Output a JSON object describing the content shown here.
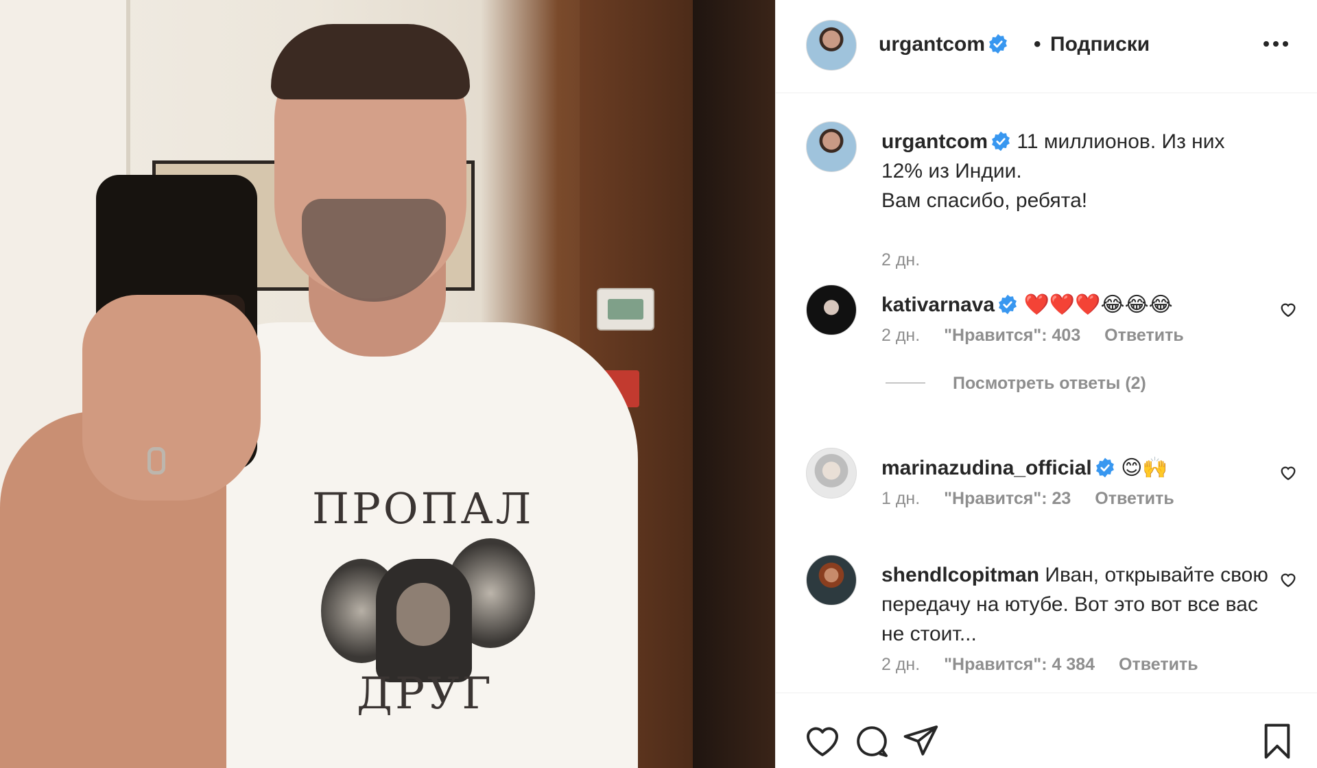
{
  "post": {
    "username": "urgantcom",
    "follow_status": "Подписки",
    "separator": "•",
    "caption_line1": "11 миллионов. Из них",
    "caption_line2": "12% из Индии.",
    "caption_line3": "Вам спасибо, ребята!",
    "time": "2 дн.",
    "image_text_top": "ПРОПАЛ",
    "image_text_bottom": "ДРУГ"
  },
  "comments": [
    {
      "username": "kativarnava",
      "text": "❤️❤️❤️😂😂😂",
      "time": "2 дн.",
      "likes": "\"Нравится\": 403",
      "reply": "Ответить",
      "view_replies": "Посмотреть ответы (2)"
    },
    {
      "username": "marinazudina_official",
      "text": "😊🙌",
      "time": "1 дн.",
      "likes": "\"Нравится\": 23",
      "reply": "Ответить"
    },
    {
      "username": "shendlcopitman",
      "text": "Иван, открывайте свою передачу на ютубе. Вот это вот все вас не стоит...",
      "time": "2 дн.",
      "likes": "\"Нравится\": 4 384",
      "reply": "Ответить"
    }
  ],
  "icons": {
    "verified": "verified-badge-icon",
    "more": "more-options-icon",
    "like": "heart-icon",
    "comment": "comment-bubble-icon",
    "share": "paper-plane-icon",
    "save": "bookmark-icon"
  },
  "colors": {
    "verified": "#3897f0",
    "text": "#262626",
    "muted": "#8e8e8e",
    "divider": "#efefef"
  }
}
